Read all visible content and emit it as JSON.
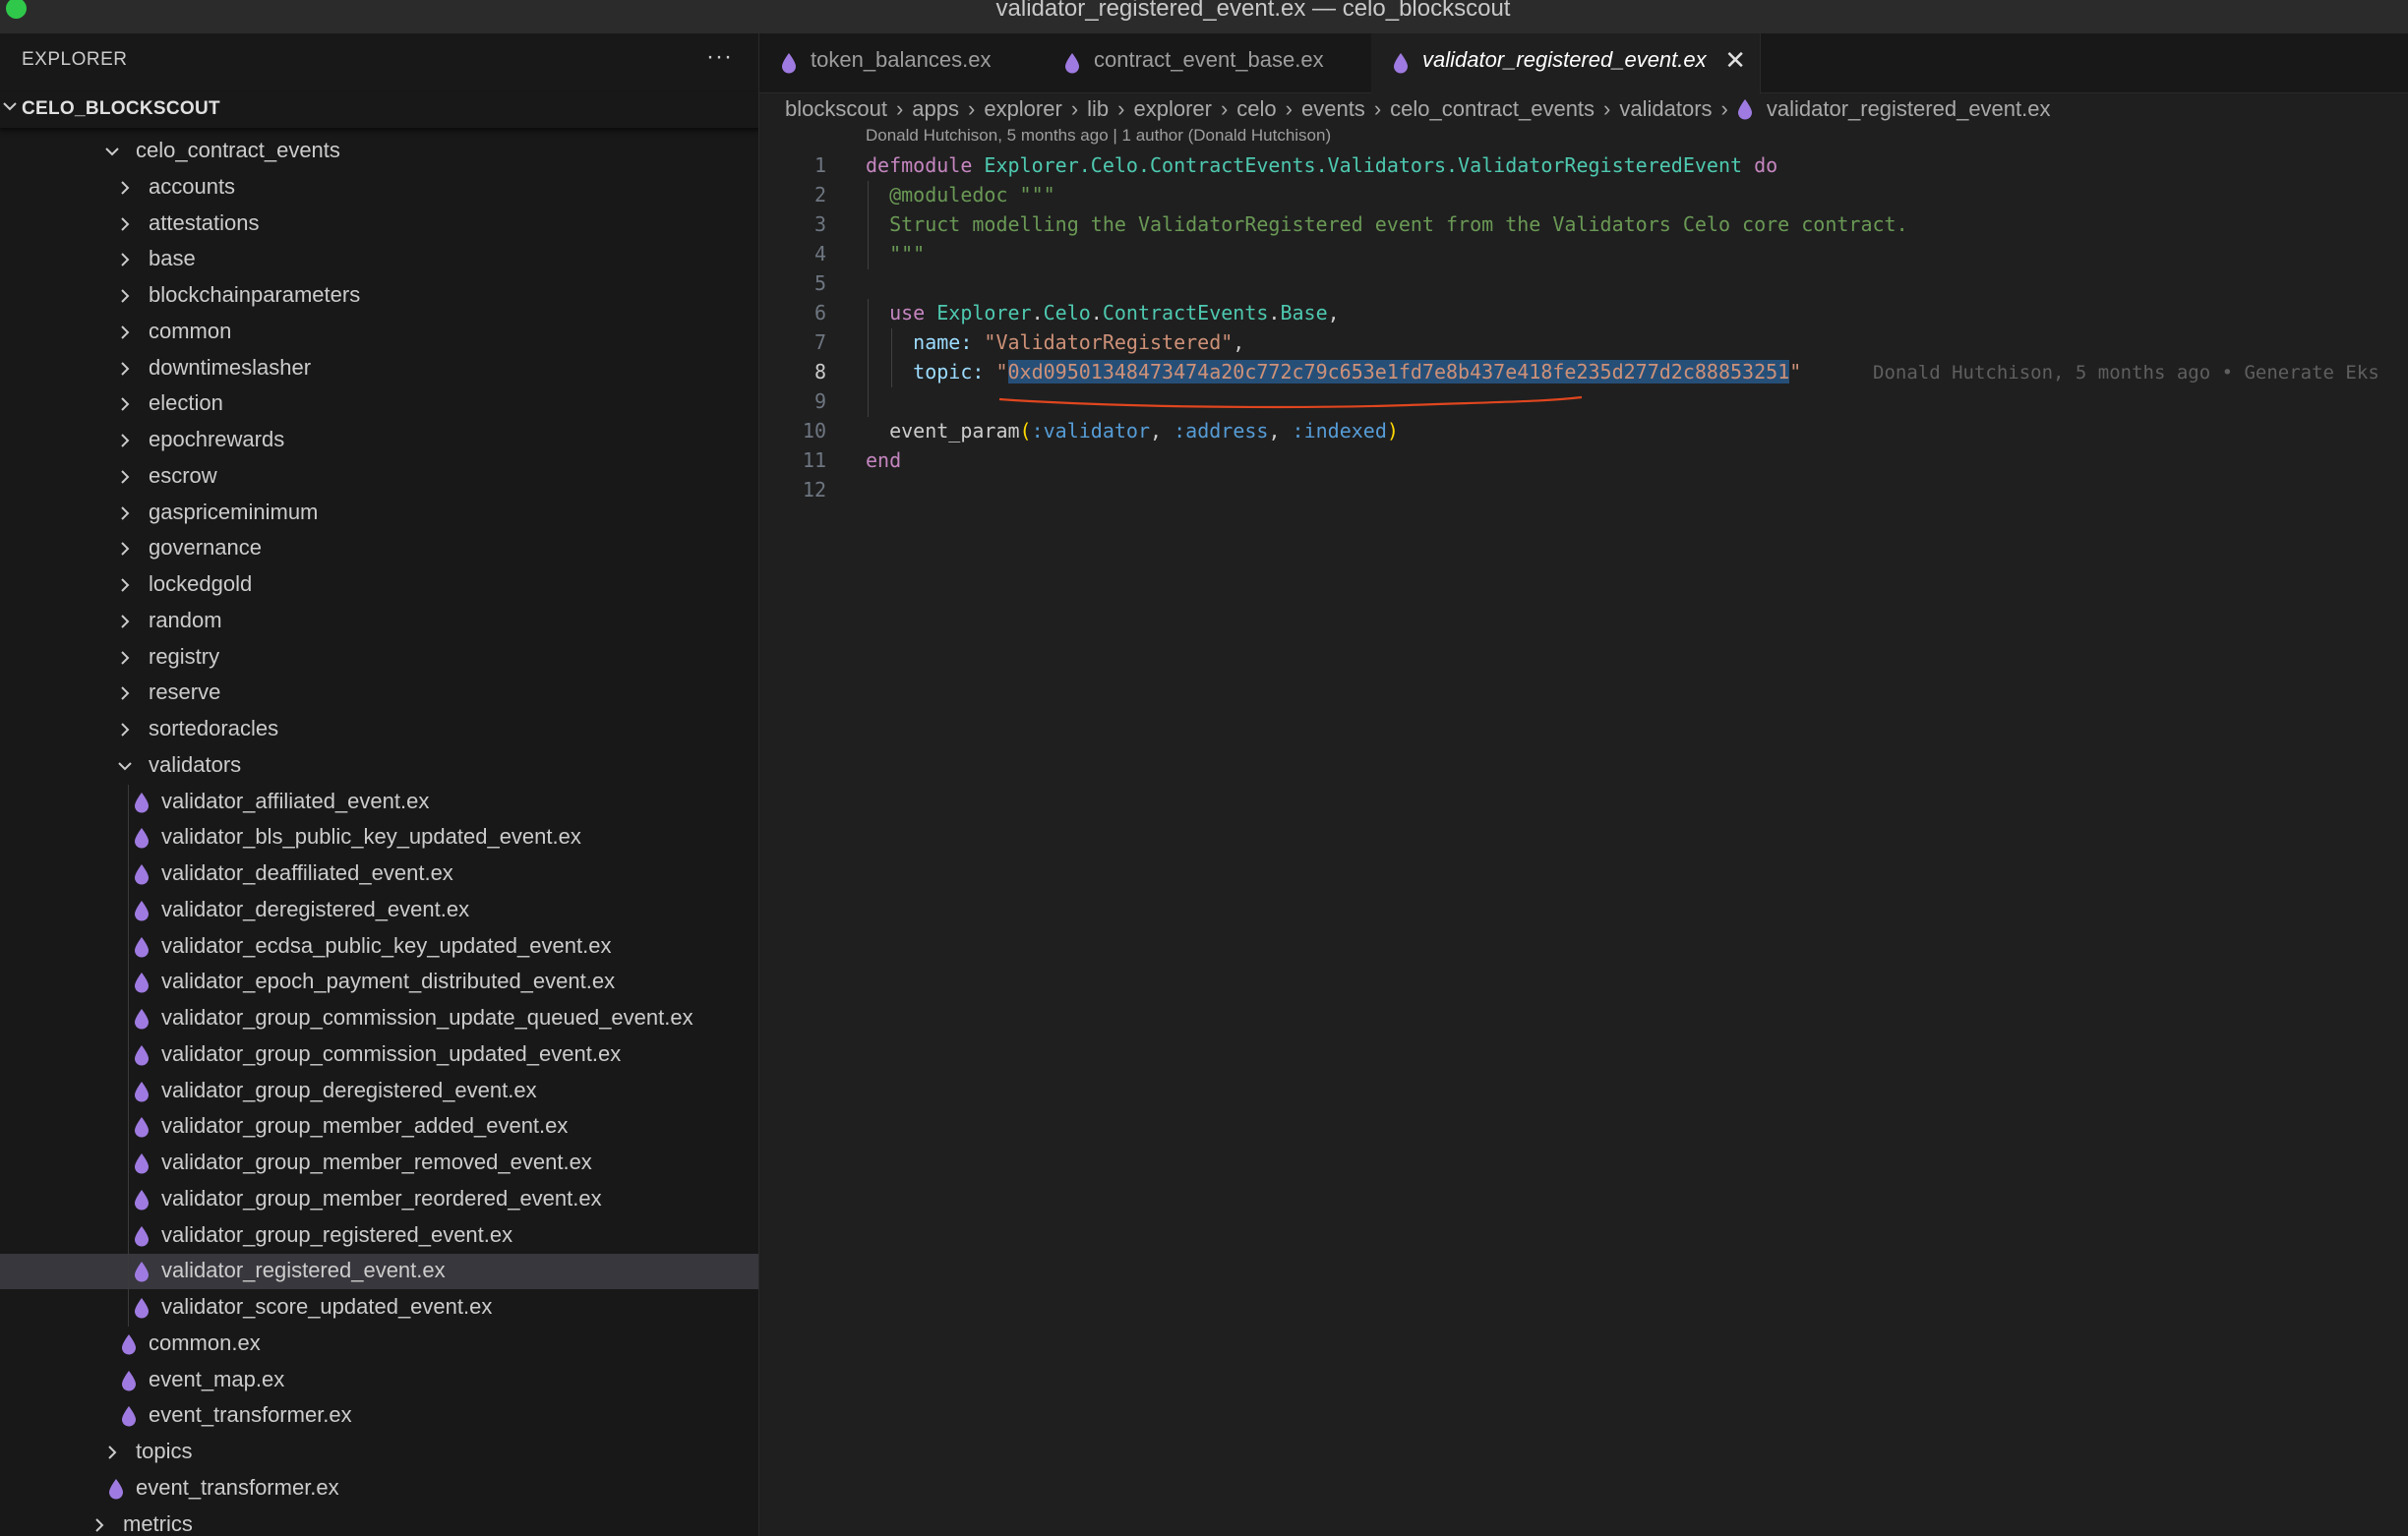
{
  "window": {
    "title": "validator_registered_event.ex — celo_blockscout"
  },
  "sidebar": {
    "header": "EXPLORER",
    "more": "···",
    "workspace": "CELO_BLOCKSCOUT",
    "items": [
      {
        "label": "celo_contract_events",
        "kind": "folder",
        "expanded": true
      },
      {
        "label": "accounts",
        "kind": "folder",
        "expanded": false
      },
      {
        "label": "attestations",
        "kind": "folder",
        "expanded": false
      },
      {
        "label": "base",
        "kind": "folder",
        "expanded": false
      },
      {
        "label": "blockchainparameters",
        "kind": "folder",
        "expanded": false
      },
      {
        "label": "common",
        "kind": "folder",
        "expanded": false
      },
      {
        "label": "downtimeslasher",
        "kind": "folder",
        "expanded": false
      },
      {
        "label": "election",
        "kind": "folder",
        "expanded": false
      },
      {
        "label": "epochrewards",
        "kind": "folder",
        "expanded": false
      },
      {
        "label": "escrow",
        "kind": "folder",
        "expanded": false
      },
      {
        "label": "gaspriceminimum",
        "kind": "folder",
        "expanded": false
      },
      {
        "label": "governance",
        "kind": "folder",
        "expanded": false
      },
      {
        "label": "lockedgold",
        "kind": "folder",
        "expanded": false
      },
      {
        "label": "random",
        "kind": "folder",
        "expanded": false
      },
      {
        "label": "registry",
        "kind": "folder",
        "expanded": false
      },
      {
        "label": "reserve",
        "kind": "folder",
        "expanded": false
      },
      {
        "label": "sortedoracles",
        "kind": "folder",
        "expanded": false
      },
      {
        "label": "validators",
        "kind": "folder",
        "expanded": true
      },
      {
        "label": "validator_affiliated_event.ex",
        "kind": "file"
      },
      {
        "label": "validator_bls_public_key_updated_event.ex",
        "kind": "file"
      },
      {
        "label": "validator_deaffiliated_event.ex",
        "kind": "file"
      },
      {
        "label": "validator_deregistered_event.ex",
        "kind": "file"
      },
      {
        "label": "validator_ecdsa_public_key_updated_event.ex",
        "kind": "file"
      },
      {
        "label": "validator_epoch_payment_distributed_event.ex",
        "kind": "file"
      },
      {
        "label": "validator_group_commission_update_queued_event.ex",
        "kind": "file"
      },
      {
        "label": "validator_group_commission_updated_event.ex",
        "kind": "file"
      },
      {
        "label": "validator_group_deregistered_event.ex",
        "kind": "file"
      },
      {
        "label": "validator_group_member_added_event.ex",
        "kind": "file"
      },
      {
        "label": "validator_group_member_removed_event.ex",
        "kind": "file"
      },
      {
        "label": "validator_group_member_reordered_event.ex",
        "kind": "file"
      },
      {
        "label": "validator_group_registered_event.ex",
        "kind": "file"
      },
      {
        "label": "validator_registered_event.ex",
        "kind": "file",
        "selected": true
      },
      {
        "label": "validator_score_updated_event.ex",
        "kind": "file"
      },
      {
        "label": "common.ex",
        "kind": "file"
      },
      {
        "label": "event_map.ex",
        "kind": "file"
      },
      {
        "label": "event_transformer.ex",
        "kind": "file"
      },
      {
        "label": "topics",
        "kind": "folder",
        "expanded": false
      },
      {
        "label": "event_transformer.ex",
        "kind": "file"
      },
      {
        "label": "metrics",
        "kind": "folder",
        "expanded": false
      }
    ]
  },
  "tabs": [
    {
      "label": "token_balances.ex",
      "active": false
    },
    {
      "label": "contract_event_base.ex",
      "active": false
    },
    {
      "label": "validator_registered_event.ex",
      "active": true,
      "close": "✕"
    }
  ],
  "breadcrumb": [
    "blockscout",
    "apps",
    "explorer",
    "lib",
    "explorer",
    "celo",
    "events",
    "celo_contract_events",
    "validators",
    "validator_registered_event.ex"
  ],
  "breadcrumb_sep": "›",
  "editor": {
    "codelens": "Donald Hutchison, 5 months ago | 1 author (Donald Hutchison)",
    "current_line": 8,
    "blame": "Donald Hutchison, 5 months ago • Generate Eks",
    "lines": [
      {
        "n": "1",
        "tokens": [
          [
            "kw",
            "defmodule "
          ],
          [
            "mod",
            "Explorer.Celo.ContractEvents.Validators.ValidatorRegisteredEvent"
          ],
          [
            "kw",
            " do"
          ]
        ]
      },
      {
        "n": "2",
        "tokens": [
          [
            "doc",
            "  @moduledoc \"\"\""
          ]
        ]
      },
      {
        "n": "3",
        "tokens": [
          [
            "doc",
            "  Struct modelling the ValidatorRegistered event from the Validators Celo core contract."
          ]
        ]
      },
      {
        "n": "4",
        "tokens": [
          [
            "doc",
            "  \"\"\""
          ]
        ]
      },
      {
        "n": "5",
        "tokens": []
      },
      {
        "n": "6",
        "tokens": [
          [
            "kw",
            "  use "
          ],
          [
            "mod",
            "Explorer"
          ],
          [
            "plain",
            "."
          ],
          [
            "mod",
            "Celo"
          ],
          [
            "plain",
            "."
          ],
          [
            "mod",
            "ContractEvents"
          ],
          [
            "plain",
            "."
          ],
          [
            "mod",
            "Base"
          ],
          [
            "plain",
            ","
          ]
        ]
      },
      {
        "n": "7",
        "tokens": [
          [
            "key",
            "    name: "
          ],
          [
            "str",
            "\"ValidatorRegistered\""
          ],
          [
            "plain",
            ","
          ]
        ]
      },
      {
        "n": "8",
        "tokens": [
          [
            "key",
            "    topic: "
          ],
          [
            "str",
            "\""
          ],
          [
            "strhl",
            "0xd09501348473474a20c772c79c653e1fd7e8b437e418fe235d277d2c88853251"
          ],
          [
            "str",
            "\""
          ]
        ]
      },
      {
        "n": "9",
        "tokens": []
      },
      {
        "n": "10",
        "tokens": [
          [
            "plain",
            "  event_param"
          ],
          [
            "paren",
            "("
          ],
          [
            "atom",
            ":validator"
          ],
          [
            "plain",
            ", "
          ],
          [
            "atom",
            ":address"
          ],
          [
            "plain",
            ", "
          ],
          [
            "atom",
            ":indexed"
          ],
          [
            "paren",
            ")"
          ]
        ]
      },
      {
        "n": "11",
        "tokens": [
          [
            "kw",
            "end"
          ]
        ]
      },
      {
        "n": "12",
        "tokens": []
      }
    ]
  },
  "colors": {
    "accent_file_icon": "#9f7be1",
    "selection": "#264f78",
    "annotation_underline": "#e0461f"
  }
}
